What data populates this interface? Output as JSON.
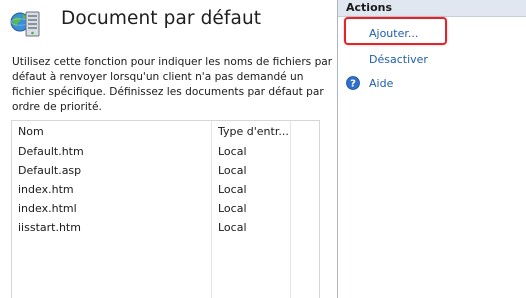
{
  "feature": {
    "title": "Document par défaut",
    "icon": "iis-default-document-icon",
    "description": "Utilisez cette fonction pour indiquer les noms de fichiers par défaut à renvoyer lorsqu'un client n'a pas demandé un fichier spécifique. Définissez les documents par défaut par ordre de priorité."
  },
  "list": {
    "columns": [
      "Nom",
      "Type d'entr..."
    ],
    "rows": [
      {
        "name": "Default.htm",
        "type": "Local"
      },
      {
        "name": "Default.asp",
        "type": "Local"
      },
      {
        "name": "index.htm",
        "type": "Local"
      },
      {
        "name": "index.html",
        "type": "Local"
      },
      {
        "name": "iisstart.htm",
        "type": "Local"
      }
    ]
  },
  "actions": {
    "header": "Actions",
    "items": [
      {
        "label": "Ajouter...",
        "icon": "none",
        "highlighted": true
      },
      {
        "label": "Désactiver",
        "icon": "none"
      },
      {
        "label": "Aide",
        "icon": "help-icon"
      }
    ]
  },
  "colors": {
    "link": "#1f5fae",
    "header_bg": "#e0e7f0",
    "highlight": "#e0262b"
  }
}
